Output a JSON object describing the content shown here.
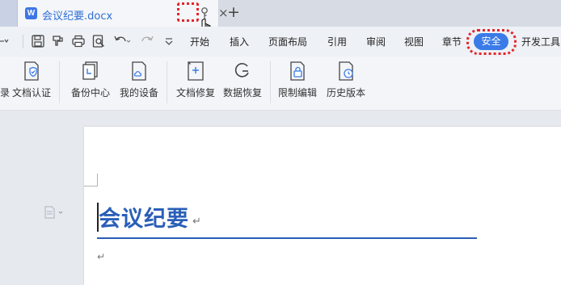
{
  "tab": {
    "badge": "W",
    "title": "会议纪要.docx",
    "close": "×",
    "new_tab": "+"
  },
  "menu": {
    "items": [
      "开始",
      "插入",
      "页面布局",
      "引用",
      "审阅",
      "视图",
      "章节"
    ],
    "active": "安全",
    "more": "开发工具"
  },
  "ribbon": {
    "left_partial": "录",
    "buttons": [
      "文档认证",
      "备份中心",
      "我的设备",
      "文档修复",
      "数据恢复",
      "限制编辑",
      "历史版本"
    ]
  },
  "document": {
    "heading": "会议纪要",
    "paragraph_mark": "↵"
  },
  "colors": {
    "accent": "#3a7be8",
    "highlight": "#e5242b",
    "heading": "#2a5fb8"
  }
}
